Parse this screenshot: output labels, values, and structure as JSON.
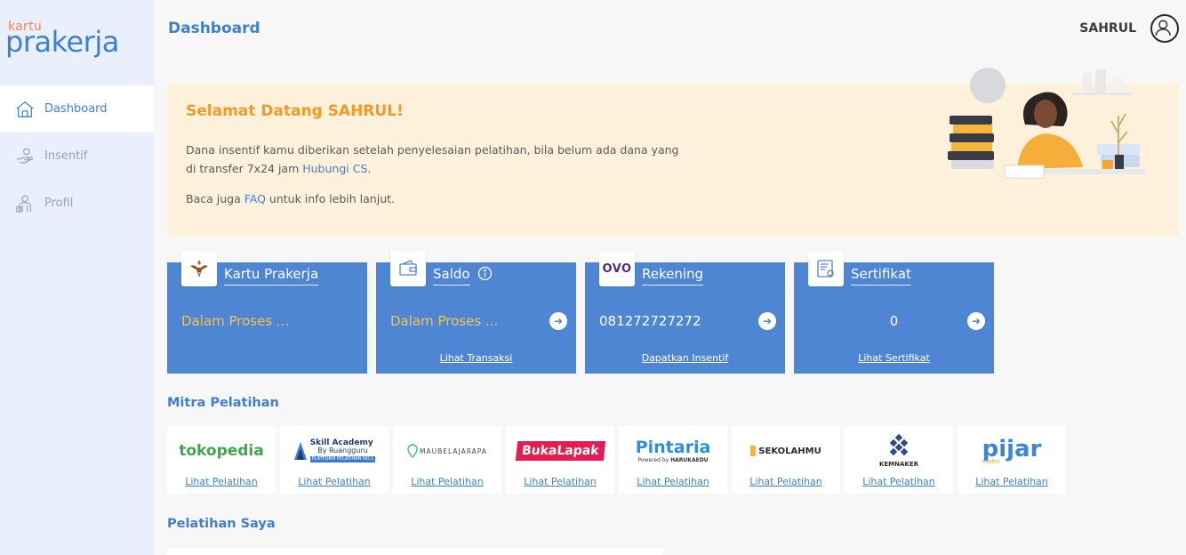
{
  "brand": {
    "kartu": "kartu",
    "prakerja": "prakerja"
  },
  "sidebar": {
    "items": [
      {
        "label": "Dashboard",
        "icon": "home-icon",
        "active": true
      },
      {
        "label": "Insentif",
        "icon": "hand-coin-icon",
        "active": false
      },
      {
        "label": "Profil",
        "icon": "person-icon",
        "active": false
      }
    ]
  },
  "header": {
    "title": "Dashboard",
    "user": "SAHRUL"
  },
  "banner": {
    "heading": "Selamat Datang SAHRUL!",
    "p1_text": "Dana insentif kamu diberikan setelah penyelesaian pelatihan, bila belum ada dana yang di transfer 7x24 jam ",
    "p1_link": "Hubungi CS",
    "p1_end": ".",
    "p2_start": "Baca juga ",
    "p2_link": "FAQ",
    "p2_end": " untuk info lebih lanjut."
  },
  "cards": [
    {
      "title": "Kartu Prakerja",
      "value": "Dalam Proses ...",
      "link": ""
    },
    {
      "title": "Saldo",
      "value": "Dalam Proses ...",
      "link": "Lihat Transaksi"
    },
    {
      "title": "Rekening",
      "value": "081272727272",
      "link": "Dapatkan Insentif",
      "icon_text": "OVO"
    },
    {
      "title": "Sertifikat",
      "value": "0",
      "link": "Lihat Sertifikat"
    }
  ],
  "sections": {
    "mitra": "Mitra Pelatihan",
    "pelatihan": "Pelatihan Saya"
  },
  "partners": [
    {
      "name": "tokopedia",
      "link": "Lihat Pelatihan"
    },
    {
      "name": "Skill Academy",
      "sub1": "By Ruangguru",
      "sub2": "PLATFORM PELATIHAN NO.1",
      "link": "Lihat Pelatihan"
    },
    {
      "name": "MAUBELAJARAPA",
      "link": "Lihat Pelatihan"
    },
    {
      "name": "BukaLapak",
      "link": "Lihat Pelatihan"
    },
    {
      "name": "Pintaria",
      "sub1": "Powered by",
      "sub2": "HARUKAEDU",
      "link": "Lihat Pelatihan"
    },
    {
      "name": "SEKOLAHMU",
      "link": "Lihat Pelatihan"
    },
    {
      "name": "KEMNAKER",
      "link": "Lihat Pelatihan"
    },
    {
      "name": "pijar",
      "sub1": "mahir",
      "link": "Lihat Pelatihan"
    }
  ],
  "colors": {
    "primary": "#3f7fd0",
    "card": "#4f86d3",
    "accent": "#f29a26",
    "pending": "#f6c24e",
    "banner": "#fdf1dc"
  }
}
